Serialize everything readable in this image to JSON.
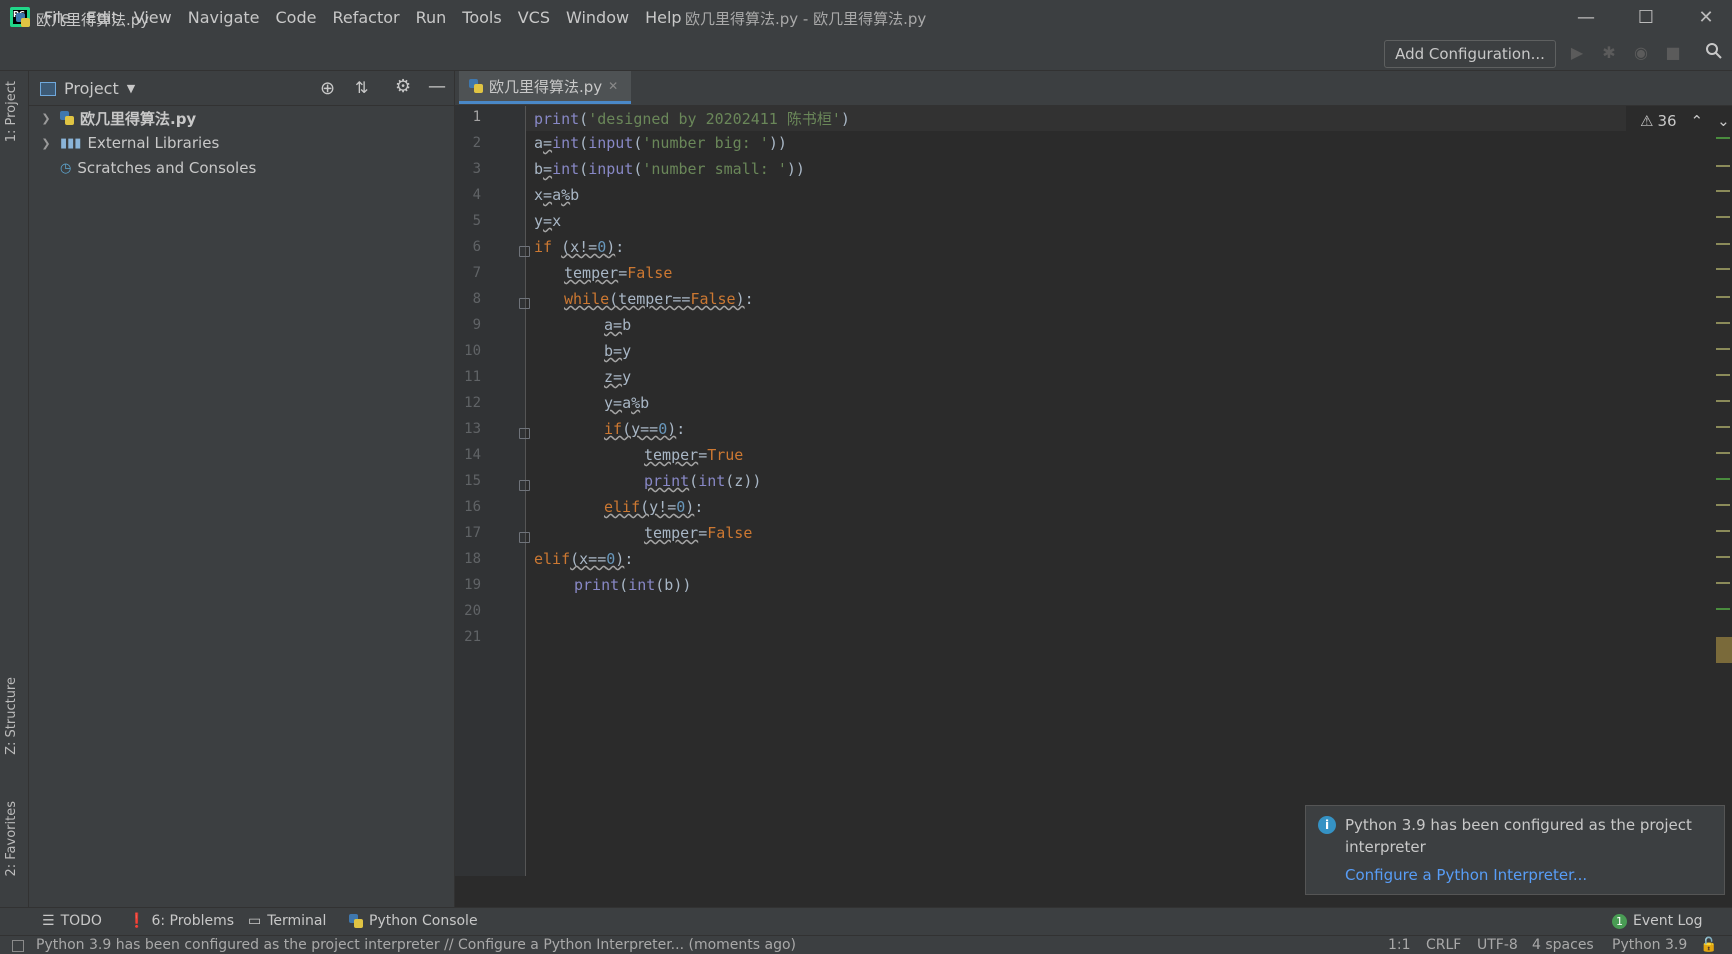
{
  "app": {
    "window_title": "欧几里得算法.py - 欧几里得算法.py",
    "logo_text": "PC"
  },
  "menu": [
    {
      "label": "File"
    },
    {
      "label": "Edit"
    },
    {
      "label": "View"
    },
    {
      "label": "Navigate"
    },
    {
      "label": "Code"
    },
    {
      "label": "Refactor"
    },
    {
      "label": "Run"
    },
    {
      "label": "Tools"
    },
    {
      "label": "VCS"
    },
    {
      "label": "Window"
    },
    {
      "label": "Help"
    }
  ],
  "navbar": {
    "file": "欧几里得算法.py",
    "add_config": "Add Configuration..."
  },
  "sidebar_tabs": {
    "project": "1: Project",
    "structure": "Z: Structure",
    "favorites": "2: Favorites"
  },
  "project": {
    "title": "Project",
    "items": [
      {
        "label": "欧几里得算法.py"
      },
      {
        "label": "External Libraries"
      },
      {
        "label": "Scratches and Consoles"
      }
    ]
  },
  "editor": {
    "tab": "欧几里得算法.py",
    "warnings": "36",
    "line_numbers": [
      "1",
      "2",
      "3",
      "4",
      "5",
      "6",
      "7",
      "8",
      "9",
      "10",
      "11",
      "12",
      "13",
      "14",
      "15",
      "16",
      "17",
      "18",
      "19",
      "20",
      "21"
    ]
  },
  "notification": {
    "message": "Python 3.9 has been configured as the project interpreter",
    "link": "Configure a Python Interpreter..."
  },
  "bottom_tools": {
    "todo": "TODO",
    "problems": "6: Problems",
    "terminal": "Terminal",
    "python_console": "Python Console",
    "event_log": "Event Log",
    "event_count": "1"
  },
  "status": {
    "message": "Python 3.9 has been configured as the project interpreter // Configure a Python Interpreter... (moments ago)",
    "position": "1:1",
    "line_sep": "CRLF",
    "encoding": "UTF-8",
    "indent": "4 spaces",
    "interpreter": "Python 3.9"
  },
  "colors": {
    "background": "#2b2b2b",
    "panel": "#3c3f41",
    "keyword": "#cc7832",
    "string": "#6a8759",
    "number": "#6897bb",
    "link": "#589df6"
  }
}
